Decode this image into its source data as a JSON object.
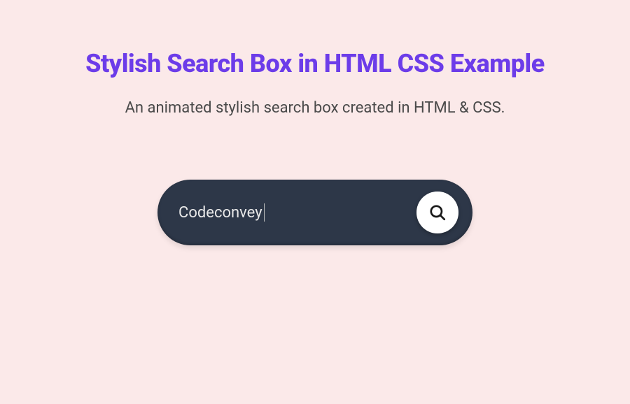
{
  "page": {
    "title": "Stylish Search Box in HTML CSS Example",
    "subtitle": "An animated stylish search box created in HTML & CSS."
  },
  "search": {
    "value": "Codeconvey",
    "placeholder": "",
    "icon": "search-icon"
  },
  "colors": {
    "background": "#fbe9e9",
    "title": "#6c3ce9",
    "subtitle": "#4a4a4a",
    "searchBox": "#2d3748",
    "searchText": "#e8e8e8",
    "buttonBg": "#ffffff",
    "iconStroke": "#1a1a1a"
  }
}
